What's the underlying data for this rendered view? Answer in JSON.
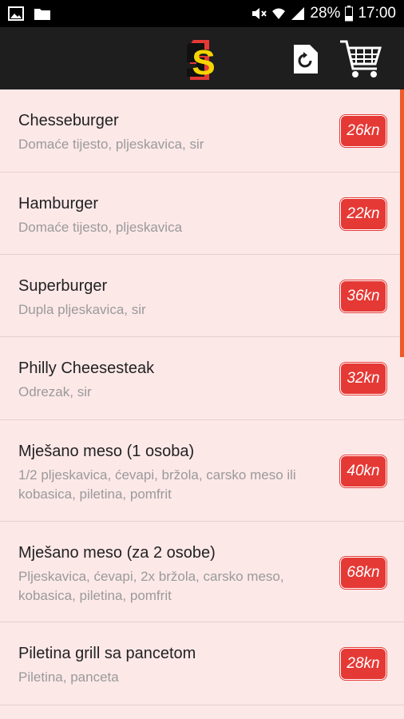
{
  "status_bar": {
    "battery": "28%",
    "time": "17:00"
  },
  "app_bar": {
    "logo_letter": "S",
    "refresh_icon": "refresh-icon",
    "cart_icon": "cart-icon"
  },
  "colors": {
    "price_bg": "#e53935",
    "list_bg": "#fde8e8",
    "appbar": "#1e1e1e",
    "scrollbar": "#f05a28"
  },
  "menu": [
    {
      "name": "Chesseburger",
      "desc": "Domaće tijesto, pljeskavica, sir",
      "price": "26kn"
    },
    {
      "name": "Hamburger",
      "desc": "Domaće tijesto, pljeskavica",
      "price": "22kn"
    },
    {
      "name": "Superburger",
      "desc": "Dupla pljeskavica, sir",
      "price": "36kn"
    },
    {
      "name": "Philly Cheesesteak",
      "desc": "Odrezak, sir",
      "price": "32kn"
    },
    {
      "name": "Mješano meso (1 osoba)",
      "desc": "1/2 pljeskavica, ćevapi, bržola, carsko meso ili kobasica, piletina, pomfrit",
      "price": "40kn"
    },
    {
      "name": "Mješano meso (za 2 osobe)",
      "desc": "Pljeskavica, ćevapi, 2x bržola, carsko meso, kobasica, piletina, pomfrit",
      "price": "68kn"
    },
    {
      "name": "Piletina grill sa pancetom",
      "desc": "Piletina, panceta",
      "price": "28kn"
    }
  ]
}
